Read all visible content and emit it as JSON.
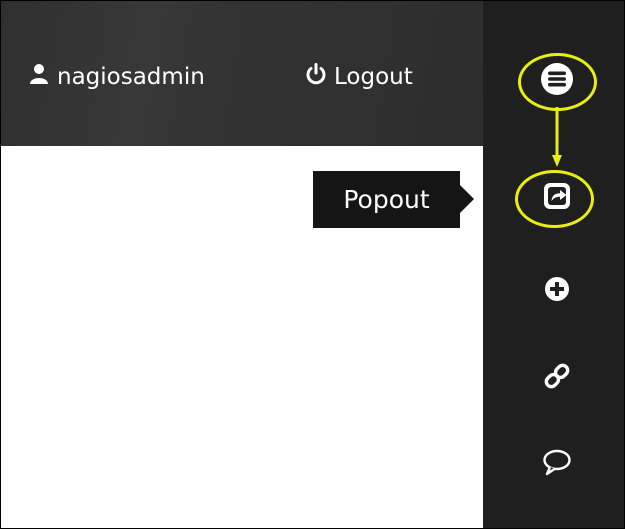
{
  "header": {
    "user_label": "nagiosadmin",
    "logout_label": "Logout"
  },
  "tooltip": {
    "text": "Popout"
  },
  "toolbar": {
    "items": [
      {
        "icon": "hamburger-menu-icon"
      },
      {
        "icon": "popout-share-icon"
      },
      {
        "icon": "add-circle-icon"
      },
      {
        "icon": "link-icon"
      },
      {
        "icon": "comment-bubble-icon"
      }
    ]
  },
  "colors": {
    "topbar_bg": "#333333",
    "rightbar_bg": "#1f1f1f",
    "highlight": "#e8ee12",
    "text": "#ffffff"
  }
}
